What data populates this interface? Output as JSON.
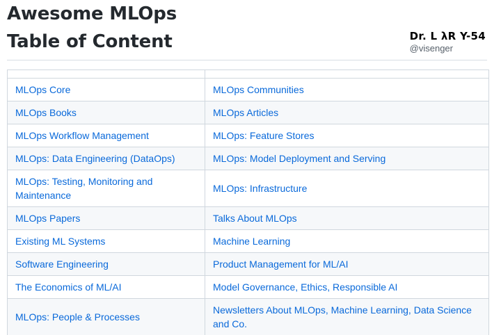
{
  "header": {
    "title_line1": "Awesome MLOps",
    "title_line2": "Table of Content",
    "brand_name": "Dr. L λR Y-54",
    "brand_handle": "@visenger"
  },
  "toc": {
    "rows": [
      {
        "left": "MLOps Core",
        "right": "MLOps Communities"
      },
      {
        "left": "MLOps Books",
        "right": "MLOps Articles"
      },
      {
        "left": "MLOps Workflow Management",
        "right": "MLOps: Feature Stores"
      },
      {
        "left": "MLOps: Data Engineering (DataOps)",
        "right": "MLOps: Model Deployment and Serving"
      },
      {
        "left": "MLOps: Testing, Monitoring and Maintenance",
        "right": "MLOps: Infrastructure"
      },
      {
        "left": "MLOps Papers",
        "right": "Talks About MLOps"
      },
      {
        "left": "Existing ML Systems",
        "right": "Machine Learning"
      },
      {
        "left": "Software Engineering",
        "right": "Product Management for ML/AI"
      },
      {
        "left": "The Economics of ML/AI",
        "right": "Model Governance, Ethics, Responsible AI"
      },
      {
        "left": "MLOps: People & Processes",
        "right": "Newsletters About MLOps, Machine Learning, Data Science and Co."
      }
    ]
  },
  "colors": {
    "link": "#0969da",
    "border": "#d0d7de",
    "stripe": "#f6f8fa",
    "text": "#24292e"
  }
}
